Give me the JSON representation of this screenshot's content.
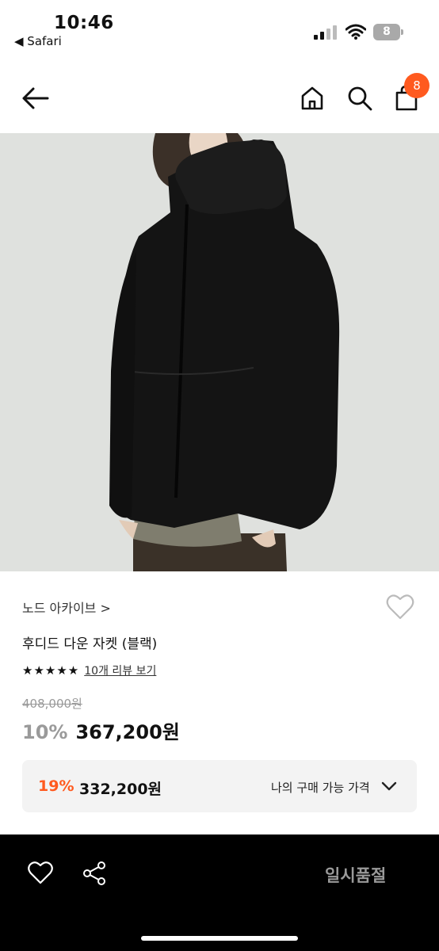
{
  "status_bar": {
    "time": "10:46",
    "back_app": "◀ Safari",
    "battery": "8"
  },
  "nav": {
    "back_icon": "arrow-left-icon",
    "home_icon": "home-icon",
    "search_icon": "search-icon",
    "bag_icon": "shopping-bag-icon",
    "cart_count": "8"
  },
  "product": {
    "brand": "노드 아카이브 >",
    "title": "후디드 다운 자켓 (블랙)",
    "stars": "★★★★★",
    "review_link": "10개 리뷰 보기",
    "original_price": "408,000원",
    "discount_rate": "10%",
    "sale_price": "367,200원"
  },
  "buy_price": {
    "rate": "19%",
    "price": "332,200원",
    "label": "나의 구매 가능 가격"
  },
  "bottom_bar": {
    "soldout_label": "일시품절"
  },
  "colors": {
    "accent": "#ff5a1f",
    "bottom_bar": "#000000",
    "image_bg": "#dfe1de"
  }
}
